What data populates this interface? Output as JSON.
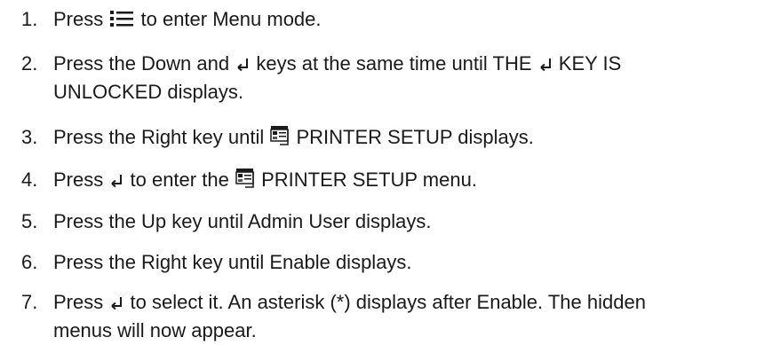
{
  "steps": [
    {
      "number": "1.",
      "parts": [
        "Press",
        "to enter Menu mode."
      ]
    },
    {
      "number": "2.",
      "parts": [
        "Press the Down and",
        "keys at the same time until THE",
        "KEY IS",
        "UNLOCKED displays."
      ]
    },
    {
      "number": "3.",
      "parts": [
        "Press the Right key until",
        "PRINTER SETUP displays."
      ]
    },
    {
      "number": "4.",
      "parts": [
        "Press",
        "to enter the",
        "PRINTER SETUP menu."
      ]
    },
    {
      "number": "5.",
      "parts": [
        "Press the Up key until Admin User displays."
      ]
    },
    {
      "number": "6.",
      "parts": [
        "Press the Right key until Enable displays."
      ]
    },
    {
      "number": "7.",
      "parts": [
        "Press",
        "to select it. An asterisk (*) displays after Enable. The hidden",
        "menus will now appear."
      ]
    }
  ],
  "icons": {
    "menu": "menu-icon",
    "enter": "enter-key-icon",
    "printer_setup": "printer-setup-icon"
  }
}
